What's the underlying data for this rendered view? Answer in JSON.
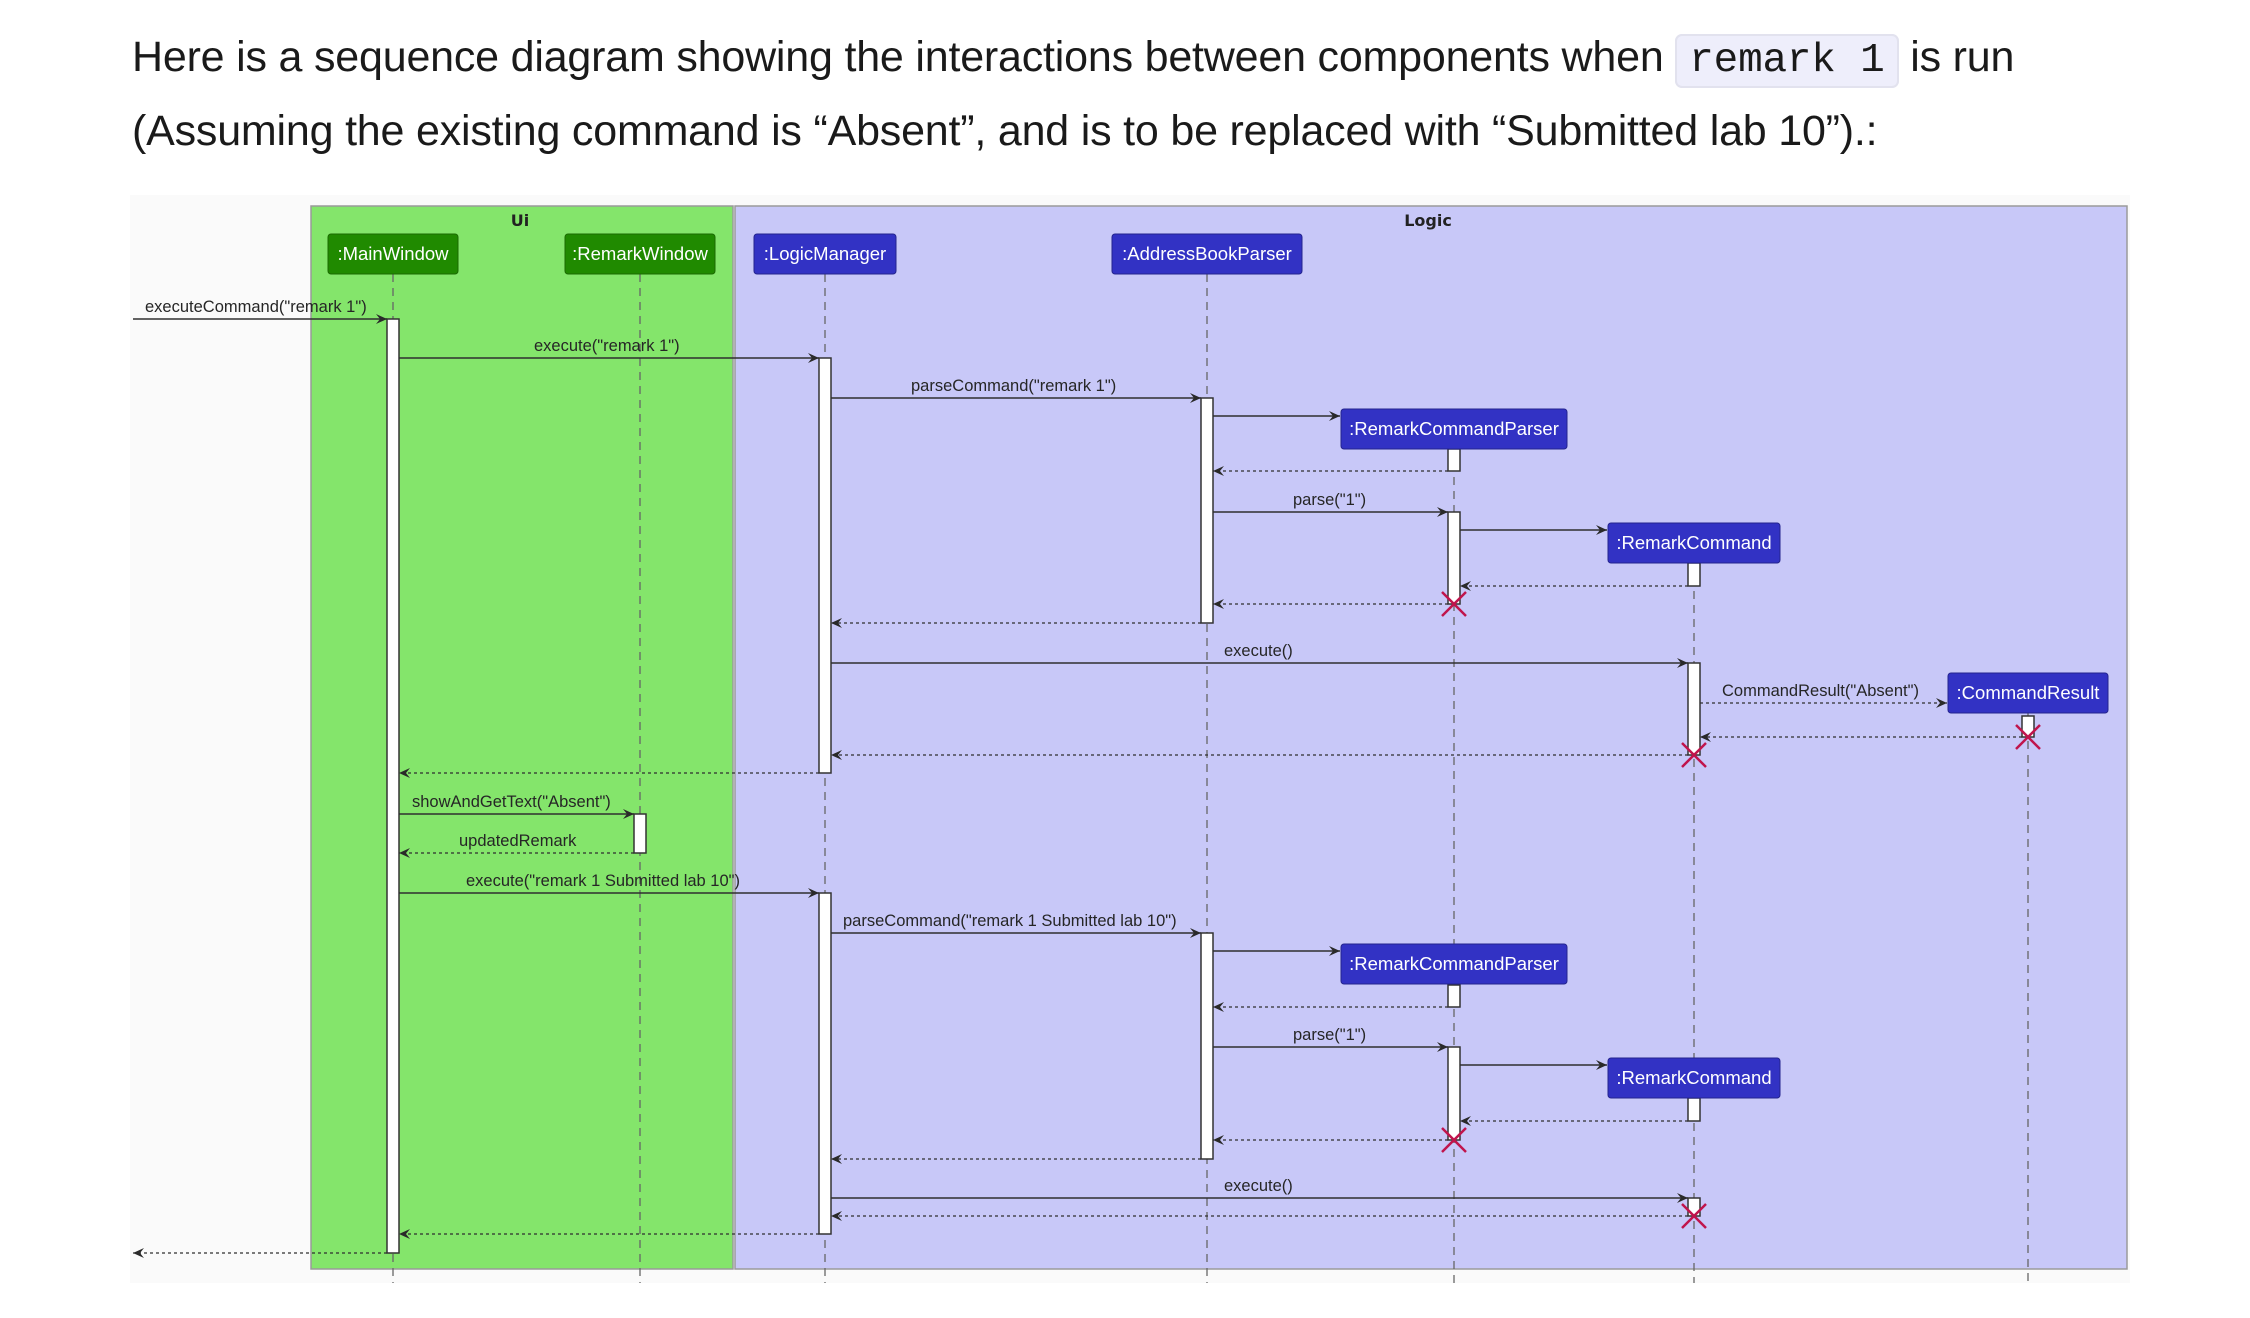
{
  "intro": {
    "line1_prefix": "Here is a sequence diagram showing the interactions between components when",
    "code": "remark 1",
    "line1_suffix": "is run",
    "line2": "(Assuming the existing command is “Absent”, and is to be replaced with “Submitted lab 10”).:"
  },
  "diagram": {
    "colors": {
      "ui_box": "#84e56b",
      "logic_box": "#c8c8f8",
      "ui_participant": "#208a00",
      "logic_participant": "#3232c4",
      "destroy": "#c0144c",
      "line": "#333333"
    },
    "boxes": [
      {
        "id": "ui",
        "title": "Ui"
      },
      {
        "id": "logic",
        "title": "Logic"
      }
    ],
    "participants": [
      {
        "id": "main",
        "label": ":MainWindow",
        "box": "ui"
      },
      {
        "id": "remarkwin",
        "label": ":RemarkWindow",
        "box": "ui"
      },
      {
        "id": "logicmgr",
        "label": ":LogicManager",
        "box": "logic"
      },
      {
        "id": "abparser",
        "label": ":AddressBookParser",
        "box": "logic"
      },
      {
        "id": "rcp1",
        "label": ":RemarkCommandParser",
        "box": "logic"
      },
      {
        "id": "rc1",
        "label": ":RemarkCommand",
        "box": "logic"
      },
      {
        "id": "cr",
        "label": ":CommandResult",
        "box": "logic"
      },
      {
        "id": "rcp2",
        "label": ":RemarkCommandParser",
        "box": "logic"
      },
      {
        "id": "rc2",
        "label": ":RemarkCommand",
        "box": "logic"
      }
    ],
    "messages": [
      {
        "from": "external",
        "to": "main",
        "label": "executeCommand(\"remark 1\")",
        "type": "call"
      },
      {
        "from": "main",
        "to": "logicmgr",
        "label": "execute(\"remark 1\")",
        "type": "call"
      },
      {
        "from": "logicmgr",
        "to": "abparser",
        "label": "parseCommand(\"remark 1\")",
        "type": "call"
      },
      {
        "from": "abparser",
        "to": "rcp1",
        "label": "",
        "type": "create"
      },
      {
        "from": "rcp1",
        "to": "abparser",
        "label": "",
        "type": "return"
      },
      {
        "from": "abparser",
        "to": "rcp1",
        "label": "parse(\"1\")",
        "type": "call"
      },
      {
        "from": "rcp1",
        "to": "rc1",
        "label": "",
        "type": "create"
      },
      {
        "from": "rc1",
        "to": "rcp1",
        "label": "",
        "type": "return"
      },
      {
        "from": "rcp1",
        "to": "abparser",
        "label": "",
        "type": "return-destroy"
      },
      {
        "from": "abparser",
        "to": "logicmgr",
        "label": "",
        "type": "return"
      },
      {
        "from": "logicmgr",
        "to": "rc1",
        "label": "execute()",
        "type": "call"
      },
      {
        "from": "rc1",
        "to": "cr",
        "label": "CommandResult(\"Absent\")",
        "type": "create"
      },
      {
        "from": "cr",
        "to": "rc1",
        "label": "",
        "type": "return-destroy"
      },
      {
        "from": "rc1",
        "to": "logicmgr",
        "label": "",
        "type": "return-destroy"
      },
      {
        "from": "logicmgr",
        "to": "main",
        "label": "",
        "type": "return"
      },
      {
        "from": "main",
        "to": "remarkwin",
        "label": "showAndGetText(\"Absent\")",
        "type": "call"
      },
      {
        "from": "remarkwin",
        "to": "main",
        "label": "updatedRemark",
        "type": "return"
      },
      {
        "from": "main",
        "to": "logicmgr",
        "label": "execute(\"remark 1 Submitted lab 10\")",
        "type": "call"
      },
      {
        "from": "logicmgr",
        "to": "abparser",
        "label": "parseCommand(\"remark 1 Submitted lab 10\")",
        "type": "call"
      },
      {
        "from": "abparser",
        "to": "rcp2",
        "label": "",
        "type": "create"
      },
      {
        "from": "rcp2",
        "to": "abparser",
        "label": "",
        "type": "return"
      },
      {
        "from": "abparser",
        "to": "rcp2",
        "label": "parse(\"1\")",
        "type": "call"
      },
      {
        "from": "rcp2",
        "to": "rc2",
        "label": "",
        "type": "create"
      },
      {
        "from": "rc2",
        "to": "rcp2",
        "label": "",
        "type": "return"
      },
      {
        "from": "rcp2",
        "to": "abparser",
        "label": "",
        "type": "return-destroy"
      },
      {
        "from": "abparser",
        "to": "logicmgr",
        "label": "",
        "type": "return"
      },
      {
        "from": "logicmgr",
        "to": "rc2",
        "label": "execute()",
        "type": "call"
      },
      {
        "from": "rc2",
        "to": "logicmgr",
        "label": "",
        "type": "return-destroy"
      },
      {
        "from": "logicmgr",
        "to": "main",
        "label": "",
        "type": "return"
      },
      {
        "from": "main",
        "to": "external",
        "label": "",
        "type": "return"
      }
    ]
  }
}
